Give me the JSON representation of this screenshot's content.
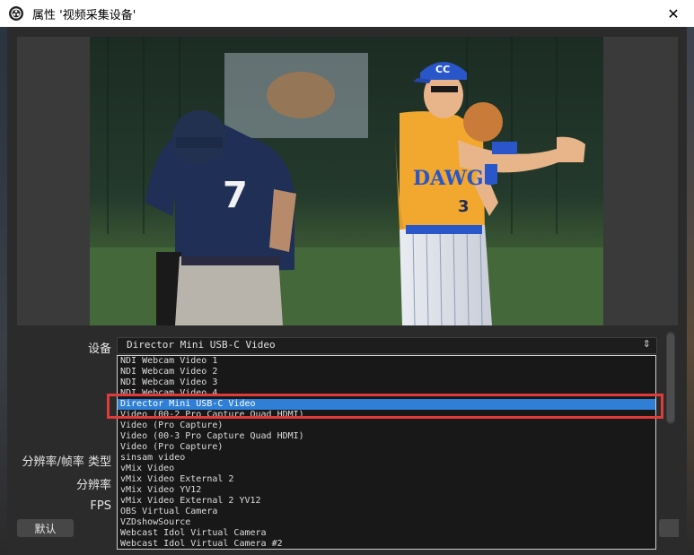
{
  "window": {
    "title": "属性 '视频采集设备'",
    "close_label": "✕"
  },
  "form": {
    "device_label": "设备",
    "resolution_fps_type_label": "分辨率/帧率 类型",
    "resolution_label": "分辨率",
    "fps_label": "FPS",
    "device_value": "Director Mini USB-C Video"
  },
  "dropdown": {
    "options": [
      "NDI Webcam Video 1",
      "NDI Webcam Video 2",
      "NDI Webcam Video 3",
      "NDI Webcam Video 4",
      "Director Mini USB-C Video",
      "Video (00-2 Pro Capture Quad HDMI)",
      "Video (Pro Capture)",
      "Video (00-3 Pro Capture Quad HDMI)",
      "Video (Pro Capture)",
      "sinsam video",
      "vMix Video",
      "vMix Video External 2",
      "vMix Video YV12",
      "vMix Video External 2 YV12",
      "OBS Virtual Camera",
      "VZDshowSource",
      "Webcast Idol Virtual Camera",
      "Webcast Idol Virtual Camera #2"
    ],
    "selected_index": 4
  },
  "buttons": {
    "defaults_label": "默认"
  },
  "preview": {
    "left_player_number": "7",
    "right_player_jersey_text": "DAWGS",
    "right_player_number": "3",
    "cap_logo": "CC"
  },
  "colors": {
    "selection": "#2f7fd6",
    "highlight_box": "#e03a3a",
    "navy_jersey": "#1f2f55",
    "gold_jersey": "#f2a72e",
    "royal_blue": "#2956c9"
  }
}
